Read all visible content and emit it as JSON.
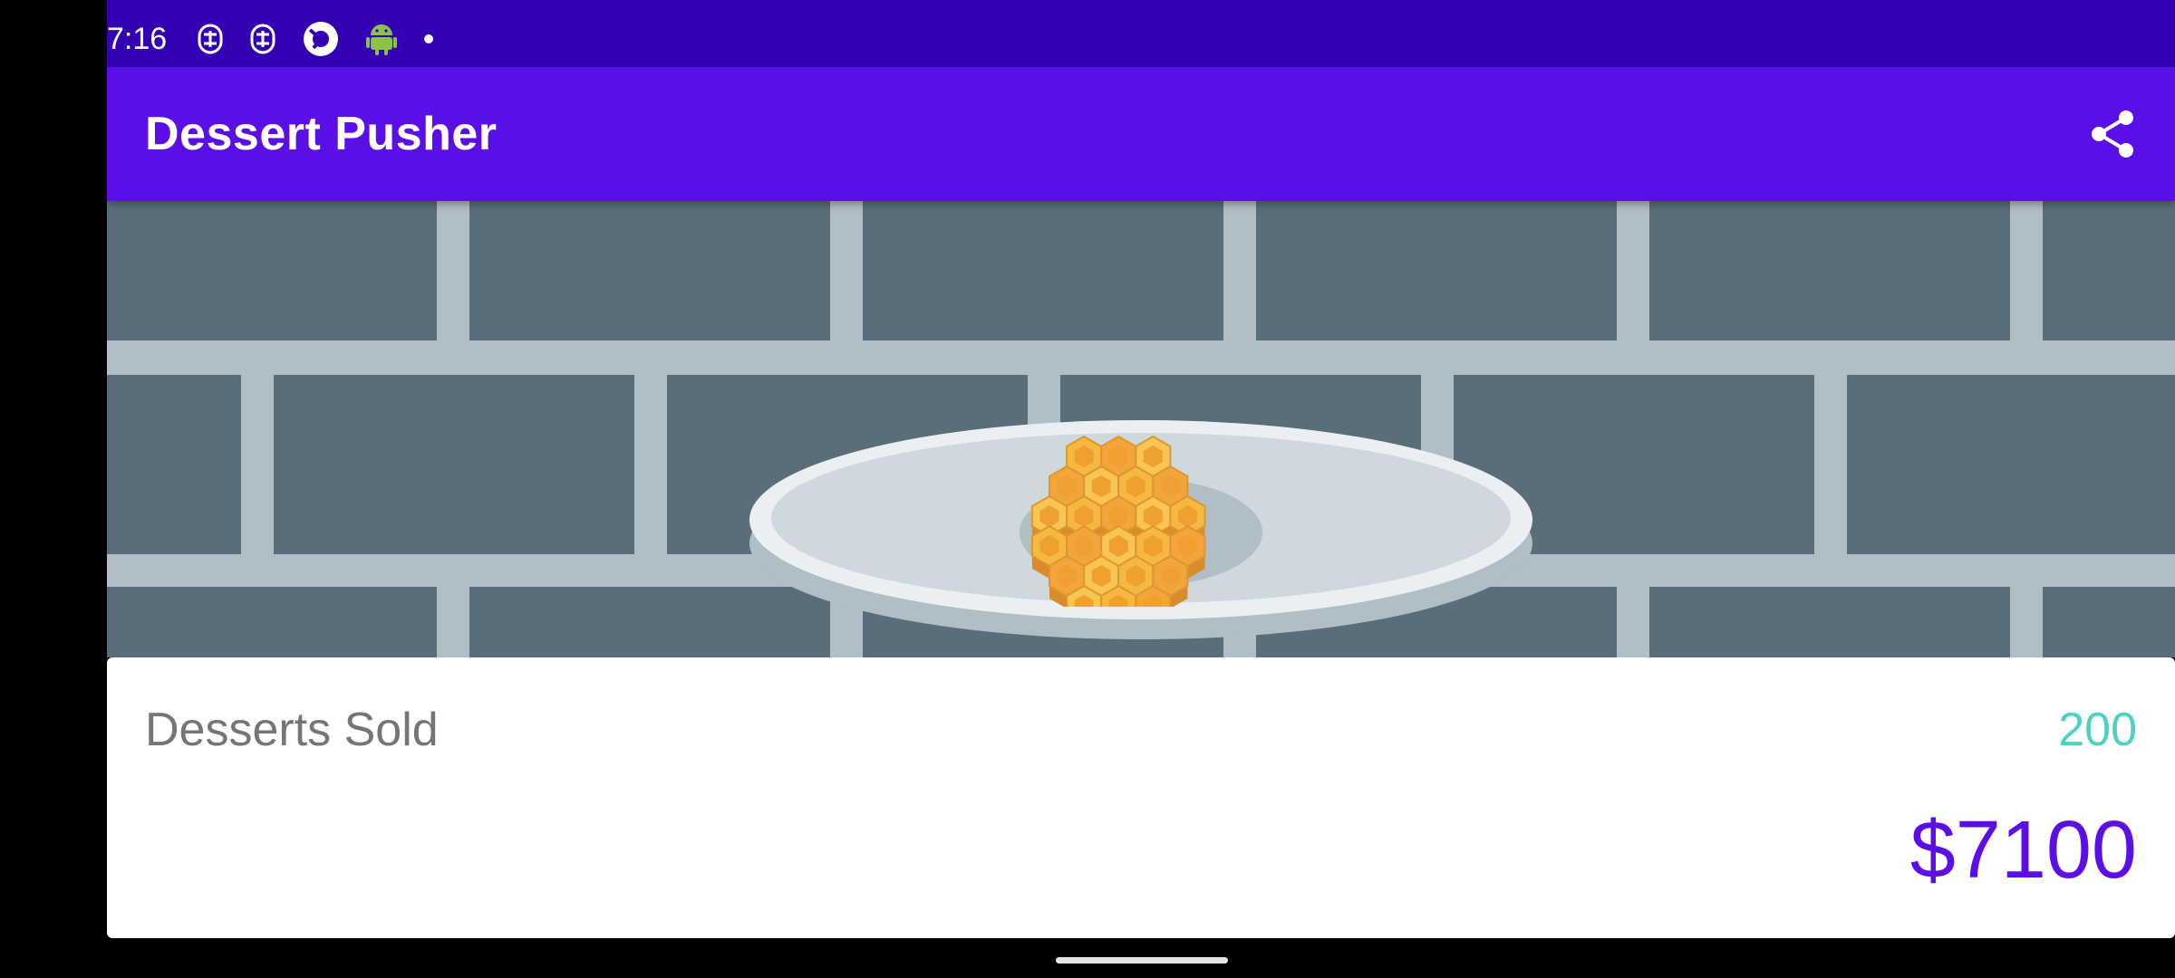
{
  "status_bar": {
    "time": "7:16",
    "icons": [
      "s-logo-icon",
      "s-logo-icon",
      "camera-app-icon",
      "android-icon",
      "more-dot-icon"
    ]
  },
  "app_bar": {
    "title": "Dessert Pusher",
    "share_icon": "share-icon"
  },
  "scene": {
    "dessert": "honeycomb",
    "colors": {
      "wall_brick": "#5a6e79",
      "wall_mortar": "#b0bec5",
      "plate_light": "#cfd8dc",
      "plate_rim": "#eceff1",
      "honey": "#f5b942"
    }
  },
  "stats": {
    "desserts_sold_label": "Desserts Sold",
    "desserts_sold_count": "200",
    "revenue": "$7100"
  },
  "colors": {
    "status_bar": "#3303b3",
    "app_bar": "#5a0fe6",
    "accent_teal": "#4fd1c1",
    "accent_purple": "#5a0fe6"
  }
}
